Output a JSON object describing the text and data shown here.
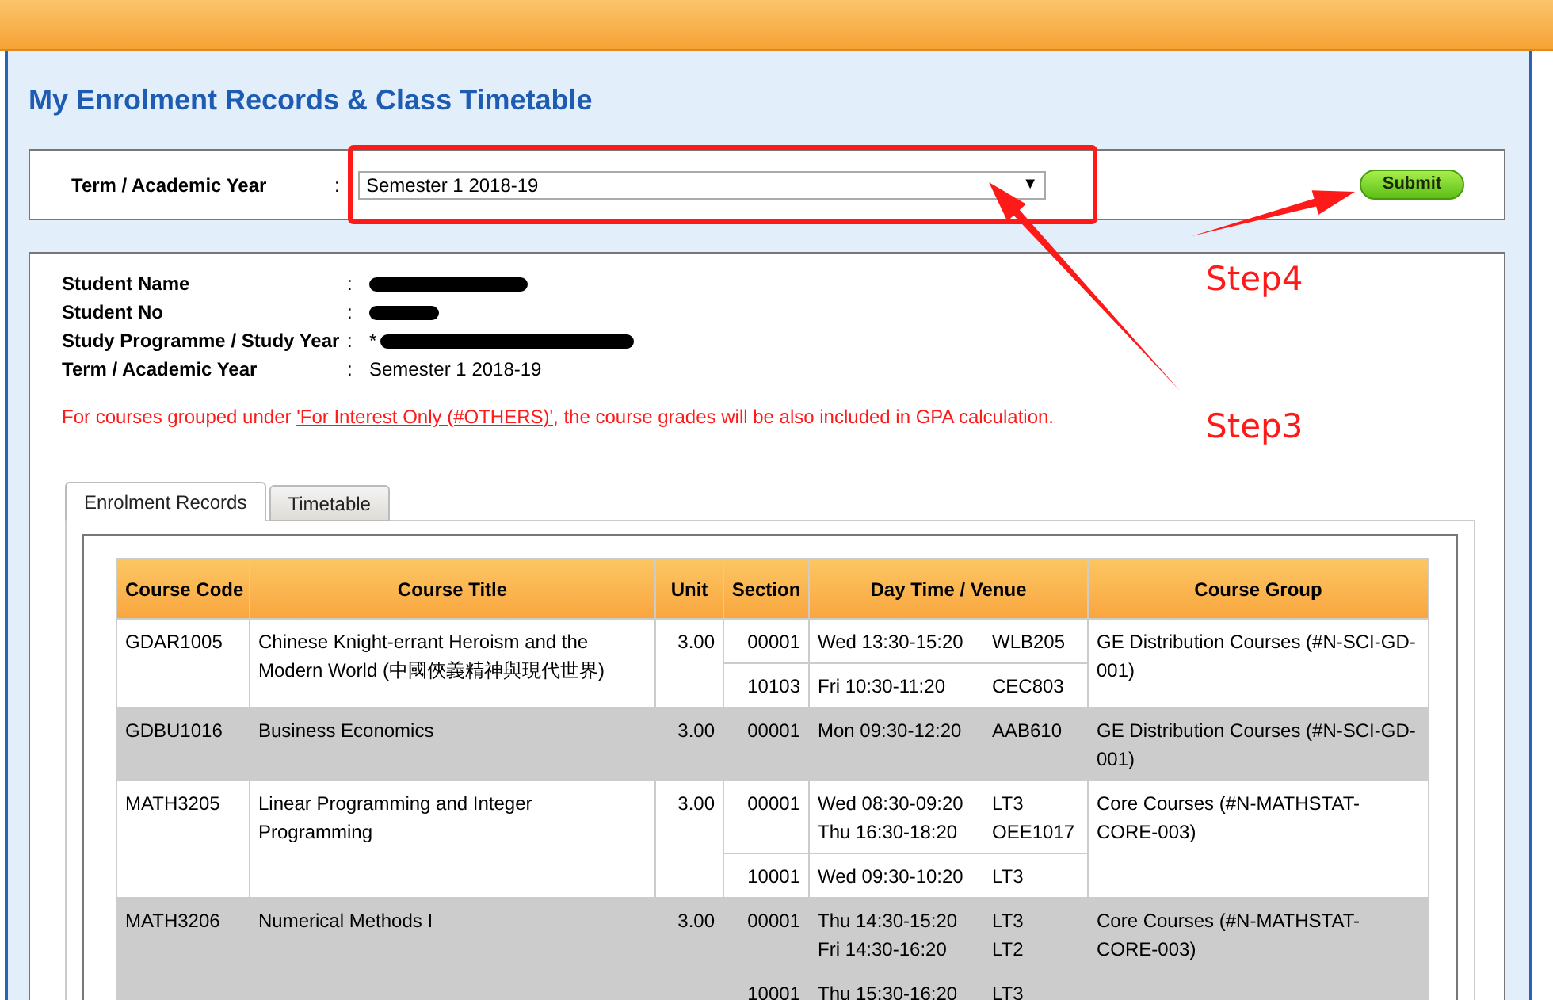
{
  "page_title": "My Enrolment Records & Class Timetable",
  "term_selector": {
    "label": "Term / Academic Year",
    "separator": ":",
    "value": "Semester 1 2018-19",
    "dropdown_icon": "▼",
    "submit": "Submit"
  },
  "student_info": [
    {
      "label": "Student Name",
      "separator": ":",
      "redacted": true
    },
    {
      "label": "Student No",
      "separator": ":",
      "redacted": true
    },
    {
      "label": "Study Programme / Study Year",
      "separator": ":",
      "value": "*",
      "redacted": true
    },
    {
      "label": "Term / Academic Year",
      "separator": ":",
      "value": "Semester 1 2018-19",
      "redacted": false
    }
  ],
  "notice": {
    "before": "For courses grouped under ",
    "link": "'For Interest Only (#OTHERS)'",
    "after": ", the course grades will be also included in GPA calculation."
  },
  "tabs": [
    {
      "label": "Enrolment Records",
      "selected": true
    },
    {
      "label": "Timetable",
      "selected": false
    }
  ],
  "table": {
    "columns": [
      "Course Code",
      "Course Title",
      "Unit",
      "Section",
      "Day Time / Venue",
      "Course Group"
    ],
    "rows": [
      {
        "code": "GDAR1005",
        "title": "Chinese Knight-errant Heroism and the Modern World (中國俠義精神與現代世界)",
        "unit": "3.00",
        "group": "GE Distribution Courses (#N-SCI-GD-001)",
        "sections": [
          {
            "section": "00001",
            "slots": [
              {
                "time": "Wed 13:30-15:20",
                "venue": "WLB205"
              }
            ]
          },
          {
            "section": "10103",
            "slots": [
              {
                "time": "Fri 10:30-11:20",
                "venue": "CEC803"
              }
            ]
          }
        ]
      },
      {
        "code": "GDBU1016",
        "title": "Business Economics",
        "unit": "3.00",
        "group": "GE Distribution Courses (#N-SCI-GD-001)",
        "sections": [
          {
            "section": "00001",
            "slots": [
              {
                "time": "Mon 09:30-12:20",
                "venue": "AAB610"
              }
            ]
          }
        ]
      },
      {
        "code": "MATH3205",
        "title": "Linear Programming and Integer Programming",
        "unit": "3.00",
        "group": "Core Courses (#N-MATHSTAT-CORE-003)",
        "sections": [
          {
            "section": "00001",
            "slots": [
              {
                "time": "Wed 08:30-09:20",
                "venue": "LT3"
              },
              {
                "time": "Thu 16:30-18:20",
                "venue": "OEE1017"
              }
            ]
          },
          {
            "section": "10001",
            "slots": [
              {
                "time": "Wed 09:30-10:20",
                "venue": "LT3"
              }
            ]
          }
        ]
      },
      {
        "code": "MATH3206",
        "title": "Numerical Methods I",
        "unit": "3.00",
        "group": "Core Courses (#N-MATHSTAT-CORE-003)",
        "sections": [
          {
            "section": "00001",
            "slots": [
              {
                "time": "Thu 14:30-15:20",
                "venue": "LT3"
              },
              {
                "time": "Fri 14:30-16:20",
                "venue": "LT2"
              }
            ]
          },
          {
            "section": "10001",
            "slots": [
              {
                "time": "Thu 15:30-16:20",
                "venue": "LT3"
              }
            ]
          }
        ]
      }
    ]
  },
  "annotations": [
    {
      "kind": "highlight-box"
    },
    {
      "kind": "arrow",
      "label": "Step4"
    },
    {
      "kind": "arrow",
      "label": "Step3"
    }
  ]
}
